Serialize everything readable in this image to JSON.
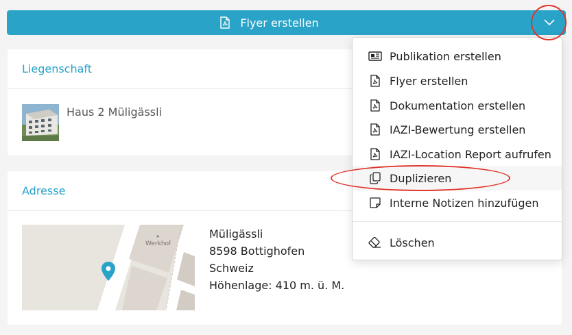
{
  "toolbar": {
    "primary_label": "Flyer erstellen",
    "primary_icon": "pdf-icon",
    "toggle_icon": "chevron-down-icon",
    "accent": "#29a3c8"
  },
  "liegenschaft": {
    "title": "Liegenschaft",
    "property_name": "Haus 2 Müligässli"
  },
  "adresse": {
    "title": "Adresse",
    "street": "Müligässli",
    "city": "8598 Bottighofen",
    "country": "Schweiz",
    "elevation": "Höhenlage: 410 m. ü. M.",
    "map_label": "Werkhof"
  },
  "menu": {
    "items": [
      {
        "label": "Publikation erstellen",
        "icon": "newspaper-icon"
      },
      {
        "label": "Flyer erstellen",
        "icon": "pdf-icon"
      },
      {
        "label": "Dokumentation erstellen",
        "icon": "pdf-icon"
      },
      {
        "label": "IAZI-Bewertung erstellen",
        "icon": "pdf-icon"
      },
      {
        "label": "IAZI-Location Report aufrufen",
        "icon": "pdf-icon"
      },
      {
        "label": "Duplizieren",
        "icon": "copy-icon"
      },
      {
        "label": "Interne Notizen hinzufügen",
        "icon": "note-icon"
      },
      {
        "label": "Löschen",
        "icon": "eraser-icon"
      }
    ]
  },
  "annotation_color": "#e0342b"
}
